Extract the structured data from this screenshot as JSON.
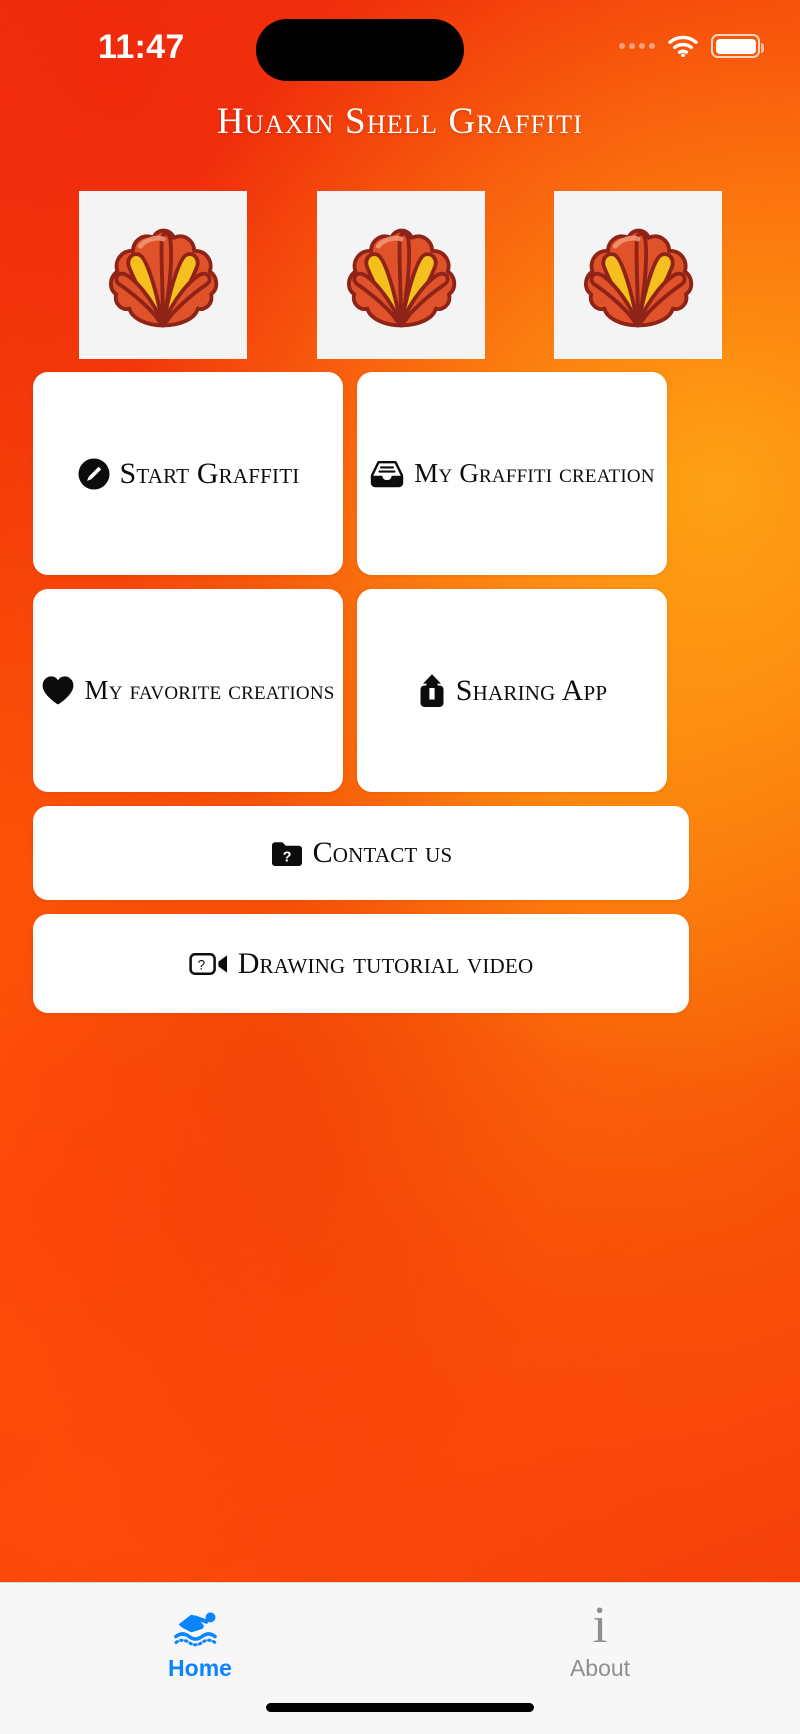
{
  "status_bar": {
    "time": "11:47",
    "signal_icon": "signal-dots-icon",
    "wifi_icon": "wifi-icon",
    "battery_icon": "battery-icon"
  },
  "header": {
    "title": "Huaxin Shell Graffiti"
  },
  "gallery": {
    "items": [
      {
        "name": "shell-thumbnail-1",
        "icon": "shell-icon"
      },
      {
        "name": "shell-thumbnail-2",
        "icon": "shell-icon"
      },
      {
        "name": "shell-thumbnail-3",
        "icon": "shell-icon"
      }
    ]
  },
  "menu": {
    "start_graffiti": {
      "label": "Start Graffiti",
      "icon": "pencil-circle-icon"
    },
    "my_creation": {
      "label": "My Graffiti creation",
      "icon": "inbox-tray-icon"
    },
    "my_favorites": {
      "label": "My favorite creations",
      "icon": "heart-icon"
    },
    "sharing_app": {
      "label": "Sharing App",
      "icon": "share-upload-icon"
    },
    "contact_us": {
      "label": "Contact us",
      "icon": "folder-question-icon"
    },
    "tutorial_video": {
      "label": "Drawing tutorial video",
      "icon": "video-question-icon"
    }
  },
  "tabbar": {
    "home": {
      "label": "Home",
      "icon": "swimmer-icon",
      "active": true
    },
    "about": {
      "label": "About",
      "icon": "info-icon",
      "active": false
    }
  },
  "colors": {
    "background_orange": "#fa5a06",
    "background_red": "#f2330b",
    "card_white": "#ffffff",
    "shell_red": "#e0532a",
    "shell_yellow": "#f5c01e",
    "shell_outline": "#8f2318",
    "tab_active": "#0a84ff",
    "tab_inactive": "#8e8e93",
    "text_black": "#0c0c0c"
  }
}
